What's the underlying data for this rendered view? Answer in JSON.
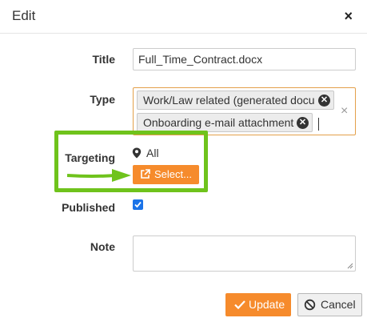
{
  "dialog": {
    "title": "Edit",
    "close_symbol": "×",
    "close_icon": "close-icon"
  },
  "form": {
    "title_label": "Title",
    "title_value": "Full_Time_Contract.docx",
    "type_label": "Type",
    "type_tags": [
      "Work/Law related (generated docu",
      "Onboarding e-mail attachment"
    ],
    "type_clear_symbol": "×",
    "targeting_label": "Targeting",
    "targeting_value": "All",
    "select_button_label": "Select...",
    "published_label": "Published",
    "published_checked": true,
    "note_label": "Note",
    "note_value": ""
  },
  "actions": {
    "update_label": "Update",
    "cancel_label": "Cancel"
  },
  "colors": {
    "accent_orange": "#f68b2c",
    "highlight_green": "#6fc31c",
    "checkbox_blue": "#1a73e8",
    "focus_border": "#e3a04a"
  },
  "icons": {
    "pin": "map-marker-icon",
    "external": "external-link-icon",
    "tag_remove": "remove-circle-icon",
    "update": "checkmark-icon",
    "cancel": "ban-icon",
    "arrow": "annotation-arrow"
  }
}
